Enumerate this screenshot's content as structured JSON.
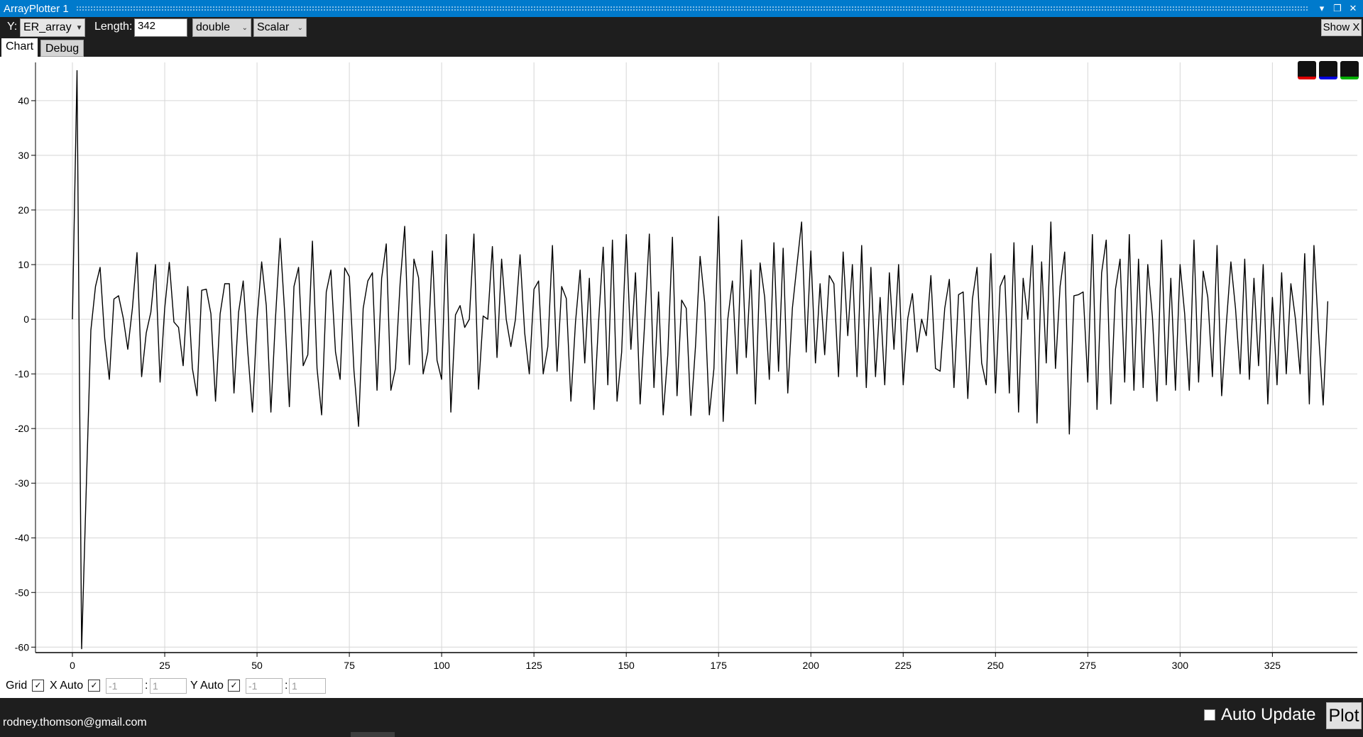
{
  "window": {
    "title": "ArrayPlotter 1"
  },
  "toolbar": {
    "y_label": "Y:",
    "y_variable": "ER_array",
    "length_label": "Length:",
    "length_value": "342",
    "type_value": "double",
    "mode_value": "Scalar",
    "show_x_label": "Show X"
  },
  "tabs": [
    {
      "label": "Chart"
    },
    {
      "label": "Debug"
    }
  ],
  "legend": {
    "colors": [
      "#e00000",
      "#0000e0",
      "#00b000"
    ]
  },
  "axis_controls": {
    "grid_label": "Grid",
    "x_auto_label": "X Auto",
    "x_min": "-1",
    "x_max": "1",
    "y_auto_label": "Y Auto",
    "y_min": "-1",
    "y_max": "1",
    "sep": ":"
  },
  "status": {
    "email": "rodney.thomson@gmail.com",
    "auto_update_label": "Auto Update",
    "plot_label": "Plot"
  },
  "chart_data": {
    "type": "line",
    "title": "",
    "xlabel": "",
    "ylabel": "",
    "xlim": [
      -10,
      348
    ],
    "ylim": [
      -61,
      47
    ],
    "grid": true,
    "x_ticks": [
      0,
      25,
      50,
      75,
      100,
      125,
      150,
      175,
      200,
      225,
      250,
      275,
      300,
      325
    ],
    "y_ticks": [
      40,
      30,
      20,
      10,
      0,
      -10,
      -20,
      -30,
      -40,
      -50,
      -60
    ],
    "series": [
      {
        "color": "#000000",
        "values": [
          0,
          45.5,
          -60.3,
          -31,
          -2,
          6,
          9.5,
          -3.5,
          -11,
          3.7,
          4.3,
          0.3,
          -5.5,
          2,
          12.2,
          -10.5,
          -2.5,
          1.3,
          10,
          -11.5,
          2,
          10.4,
          -0.5,
          -1.5,
          -8.5,
          6,
          -9,
          -14,
          5.3,
          5.5,
          1,
          -15,
          1,
          6.5,
          6.5,
          -13.5,
          1.3,
          7,
          -6,
          -17,
          0,
          10.5,
          2.5,
          -17,
          0.3,
          14.8,
          1,
          -16,
          6,
          9.5,
          -8.5,
          -6.5,
          14.3,
          -9,
          -17.5,
          5,
          9,
          -6,
          -11,
          9.4,
          7.8,
          -9.4,
          -19.6,
          2,
          7,
          8.5,
          -13,
          7.5,
          13.8,
          -13,
          -9,
          6.5,
          17,
          -8.3,
          11,
          7.6,
          -10,
          -6,
          12.5,
          -7.5,
          -11,
          15.5,
          -17,
          0.8,
          2.5,
          -1.5,
          0,
          15.6,
          -12.8,
          0.6,
          0,
          13.3,
          -7,
          11,
          0,
          -5,
          0,
          11.8,
          -2.5,
          -10,
          5.5,
          7,
          -10,
          -5,
          13.5,
          -9.5,
          6,
          3.8,
          -15,
          -0.5,
          9,
          -8,
          7.5,
          -16.5,
          -0.5,
          13.2,
          -12,
          14.5,
          -15,
          -6,
          15.5,
          -5.5,
          8.5,
          -15.5,
          -0.5,
          15.6,
          -12.5,
          5,
          -17.5,
          -6.5,
          15,
          -14,
          3.5,
          2,
          -17.6,
          -5,
          11.5,
          3,
          -17.5,
          -9,
          18.8,
          -18.7,
          0,
          7,
          -10,
          14.5,
          -7,
          9,
          -15.5,
          10.3,
          4,
          -11,
          14,
          -9.5,
          13,
          -13.5,
          2,
          10,
          17.8,
          -6,
          12.5,
          -8,
          6.5,
          -6.5,
          8,
          6.5,
          -10.5,
          12.3,
          -3,
          10,
          -10.5,
          13.5,
          -12.5,
          9.5,
          -10.5,
          4,
          -12,
          8.5,
          -5.5,
          10,
          -12,
          0.2,
          4.7,
          -6,
          0,
          -3,
          8,
          -9,
          -9.5,
          2,
          7.3,
          -12.5,
          4.5,
          5,
          -14.5,
          3.7,
          9.5,
          -8,
          -12,
          12,
          -13.5,
          6,
          8,
          -13.5,
          14,
          -17,
          7.5,
          0,
          13.5,
          -19,
          10.5,
          -8,
          17.8,
          -9,
          6,
          12.3,
          -21,
          4.3,
          4.5,
          5,
          -11.5,
          15.5,
          -16.5,
          8.5,
          14.5,
          -15.5,
          5.5,
          11,
          -11.5,
          15.5,
          -13,
          11,
          -12.5,
          10,
          0.5,
          -15,
          14.5,
          -12,
          7.5,
          -13,
          10,
          1,
          -13,
          14.5,
          -11.5,
          8.8,
          4,
          -10.5,
          13.5,
          -14,
          -1,
          10.5,
          2,
          -10,
          11,
          -11,
          7.5,
          -8.5,
          10,
          -15.5,
          4,
          -12,
          8.5,
          -10,
          6.5,
          0,
          -10,
          12,
          -15.5,
          13.5,
          -2.5,
          -15.7,
          3.3
        ]
      }
    ]
  }
}
